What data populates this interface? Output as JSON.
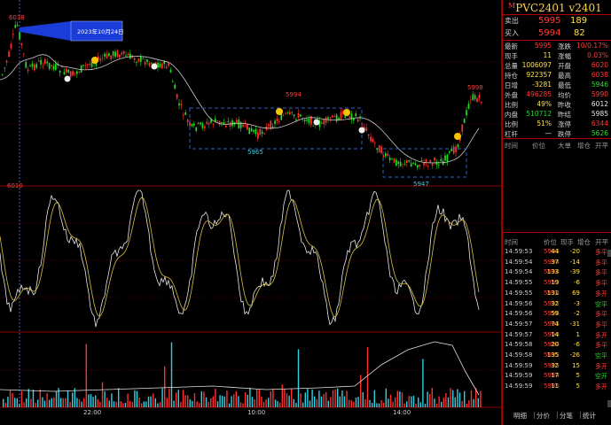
{
  "panel": {
    "title_marker": "M",
    "title": "PVC2401  v2401",
    "sell": {
      "label": "卖出",
      "price": "5995",
      "vol": "189"
    },
    "buy": {
      "label": "买入",
      "price": "5994",
      "vol": "82"
    },
    "stats": [
      {
        "l1": "最新",
        "v1": "5995",
        "c1": "red",
        "l2": "涨跌",
        "v2": "10/0.17%",
        "c2": "red"
      },
      {
        "l1": "现手",
        "v1": "11",
        "c1": "yel",
        "l2": "涨幅",
        "v2": "0.03%",
        "c2": "red"
      },
      {
        "l1": "总量",
        "v1": "1006097",
        "c1": "yel",
        "l2": "开盘",
        "v2": "6020",
        "c2": "red"
      },
      {
        "l1": "持仓",
        "v1": "922357",
        "c1": "yel",
        "l2": "最高",
        "v2": "6038",
        "c2": "red"
      },
      {
        "l1": "日增",
        "v1": "-3281",
        "c1": "yel",
        "l2": "最低",
        "v2": "5946",
        "c2": "grn"
      },
      {
        "l1": "外盘",
        "v1": "496285",
        "c1": "red",
        "l2": "均价",
        "v2": "5990",
        "c2": "red"
      },
      {
        "l1": "比例",
        "v1": "49%",
        "c1": "yel",
        "l2": "昨收",
        "v2": "6012",
        "c2": "wht"
      },
      {
        "l1": "内盘",
        "v1": "510712",
        "c1": "grn",
        "l2": "昨结",
        "v2": "5985",
        "c2": "wht"
      },
      {
        "l1": "比例",
        "v1": "51%",
        "c1": "yel",
        "l2": "涨停",
        "v2": "6344",
        "c2": "red"
      },
      {
        "l1": "杠杆",
        "v1": "—",
        "c1": "wht",
        "l2": "跌停",
        "v2": "5626",
        "c2": "grn"
      }
    ],
    "tick_headers": [
      "时间",
      "价位",
      "大单",
      "增仓",
      "开平"
    ],
    "tick_headers2": [
      "时间",
      "价位",
      "现手",
      "增仓",
      "开平"
    ],
    "ticks": [
      {
        "t": "14:59:53",
        "p": "5993",
        "v": "44",
        "d": "-20",
        "o": "多平",
        "oc": "red"
      },
      {
        "t": "14:59:54",
        "p": "5994",
        "v": "37",
        "d": "-14",
        "o": "多平",
        "oc": "red"
      },
      {
        "t": "14:59:54",
        "p": "5994",
        "v": "133",
        "d": "-39",
        "o": "多平",
        "oc": "red"
      },
      {
        "t": "14:59:55",
        "p": "5993",
        "v": "19",
        "d": "-6",
        "o": "多平",
        "oc": "red"
      },
      {
        "t": "14:59:55",
        "p": "5994",
        "v": "131",
        "d": "69",
        "o": "多开",
        "oc": "red"
      },
      {
        "t": "14:59:56",
        "p": "5995",
        "v": "32",
        "d": "-3",
        "o": "空平",
        "oc": "grn"
      },
      {
        "t": "14:59:56",
        "p": "5994",
        "v": "59",
        "d": "-2",
        "o": "多平",
        "oc": "red"
      },
      {
        "t": "14:59:57",
        "p": "5993",
        "v": "74",
        "d": "-31",
        "o": "多平",
        "oc": "red"
      },
      {
        "t": "14:59:57",
        "p": "5994",
        "v": "14",
        "d": "1",
        "o": "多开",
        "oc": "red"
      },
      {
        "t": "14:59:58",
        "p": "5994",
        "v": "20",
        "d": "-6",
        "o": "多平",
        "oc": "red"
      },
      {
        "t": "14:59:58",
        "p": "5995",
        "v": "135",
        "d": "-26",
        "o": "空平",
        "oc": "grn"
      },
      {
        "t": "14:59:59",
        "p": "5995",
        "v": "32",
        "d": "15",
        "o": "多开",
        "oc": "red"
      },
      {
        "t": "14:59:59",
        "p": "5994",
        "v": "17",
        "d": "5",
        "o": "空开",
        "oc": "grn"
      },
      {
        "t": "14:59:59",
        "p": "5995",
        "v": "11",
        "d": "5",
        "o": "多开",
        "oc": "red"
      }
    ],
    "tabs": [
      "明细",
      "分价",
      "分笔",
      "统计"
    ]
  },
  "chart": {
    "tooltip": "2023年10月24日",
    "price_labels": {
      "high": "6038",
      "left_low": "6010",
      "mid_high": "5994",
      "box1_low": "5965",
      "box2_low": "5947",
      "last_high": "5998"
    },
    "time_labels": [
      "22:00",
      "10:00",
      "14:00"
    ],
    "colors": {
      "up": "#ff3030",
      "down": "#20e020",
      "grid": "#8b0000",
      "box": "#3060c0",
      "osc1": "#e8e8e8",
      "osc2": "#d8c040",
      "vol_up": "#ff3030",
      "vol_down": "#30d0e0"
    }
  }
}
